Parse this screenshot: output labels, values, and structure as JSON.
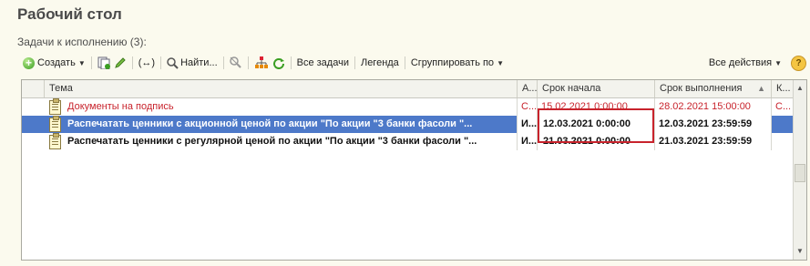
{
  "window": {
    "title": "Рабочий стол"
  },
  "section": {
    "title": "Задачи к исполнению (3):"
  },
  "toolbar": {
    "create_label": "Создать",
    "find_label": "Найти...",
    "all_tasks_label": "Все задачи",
    "legend_label": "Легенда",
    "group_by_label": "Сгруппировать по",
    "all_actions_label": "Все действия",
    "help_label": "?",
    "refresh_text": "(↔)"
  },
  "table": {
    "columns": [
      "Тема",
      "А...",
      "Срок начала",
      "Срок выполнения",
      "К..."
    ],
    "rows": [
      {
        "subject": "Документы на подпись",
        "author": "С...",
        "start": "15.02.2021 0:00:00",
        "due": "28.02.2021 15:00:00",
        "k": "С...",
        "style": "red"
      },
      {
        "subject": "Распечатать ценники с акционной ценой по акции \"По акции \"3 банки фасоли \"...",
        "author": "И...",
        "start": "12.03.2021 0:00:00",
        "due": "12.03.2021 23:59:59",
        "k": "",
        "style": "selected"
      },
      {
        "subject": "Распечатать ценники с регулярной ценой по акции \"По акции \"3 банки фасоли \"...",
        "author": "И...",
        "start": "21.03.2021 0:00:00",
        "due": "21.03.2021 23:59:59",
        "k": "",
        "style": "bold"
      }
    ]
  },
  "colors": {
    "accent": "#4d79c9",
    "warning": "#c8232c",
    "title": "#4a4a4a"
  }
}
